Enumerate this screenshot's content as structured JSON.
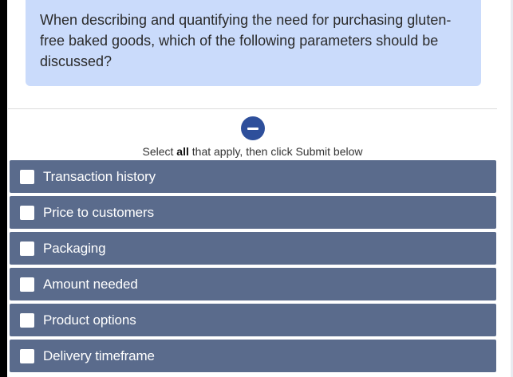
{
  "question": {
    "text": "When describing and quantifying the need for purchasing gluten-free baked goods, which of the following parameters should be discussed?"
  },
  "collapse_button": {
    "icon": "minus-icon",
    "color": "#2e4f9b"
  },
  "instructions": {
    "prefix": "Select ",
    "emphasis": "all",
    "suffix": " that apply, then click Submit below"
  },
  "options": [
    {
      "label": "Transaction history",
      "checked": false
    },
    {
      "label": "Price to customers",
      "checked": false
    },
    {
      "label": "Packaging",
      "checked": false
    },
    {
      "label": "Amount needed",
      "checked": false
    },
    {
      "label": "Product options",
      "checked": false
    },
    {
      "label": "Delivery timeframe",
      "checked": false
    }
  ],
  "colors": {
    "question_bg": "#cadbfb",
    "option_bg": "#5a6b8c",
    "accent": "#2e4f9b"
  }
}
